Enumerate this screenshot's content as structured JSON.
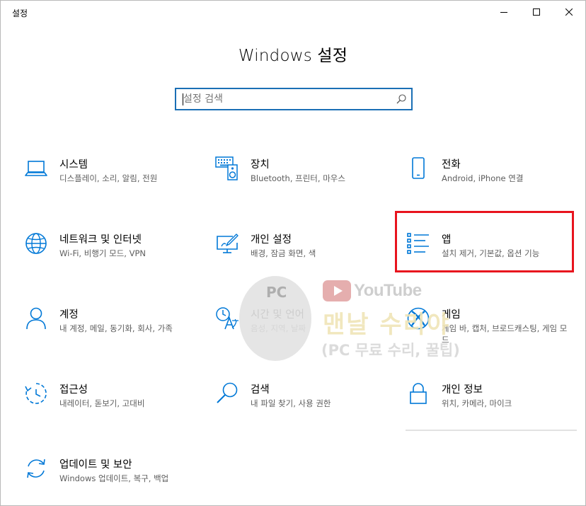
{
  "window": {
    "title": "설정",
    "buttons": {
      "minimize": "minimize",
      "maximize": "maximize",
      "close": "close"
    }
  },
  "main": {
    "title": "Windows 설정",
    "search": {
      "placeholder": "설정 검색",
      "value": ""
    }
  },
  "tiles": [
    {
      "title": "시스템",
      "desc": "디스플레이, 소리, 알림, 전원",
      "icon": "laptop-icon"
    },
    {
      "title": "장치",
      "desc": "Bluetooth, 프린터, 마우스",
      "icon": "keyboard-speaker-icon"
    },
    {
      "title": "전화",
      "desc": "Android, iPhone 연결",
      "icon": "phone-icon"
    },
    {
      "title": "네트워크 및 인터넷",
      "desc": "Wi-Fi, 비행기 모드, VPN",
      "icon": "globe-icon"
    },
    {
      "title": "개인 설정",
      "desc": "배경, 잠금 화면, 색",
      "icon": "monitor-pen-icon"
    },
    {
      "title": "앱",
      "desc": "설치 제거, 기본값, 옵션 기능",
      "icon": "app-list-icon"
    },
    {
      "title": "계정",
      "desc": "내 계정, 메일, 동기화, 회사, 가족",
      "icon": "person-icon"
    },
    {
      "title": "시간 및 언어",
      "desc": "음성, 지역, 날짜",
      "icon": "time-language-icon"
    },
    {
      "title": "게임",
      "desc": "게임 바, 캡처, 브로드캐스팅, 게임 모드",
      "icon": "xbox-icon"
    },
    {
      "title": "접근성",
      "desc": "내레이터, 돋보기, 고대비",
      "icon": "ease-of-access-icon"
    },
    {
      "title": "검색",
      "desc": "내 파일 찾기, 사용 권한",
      "icon": "magnifier-icon"
    },
    {
      "title": "개인 정보",
      "desc": "위치, 카메라, 마이크",
      "icon": "lock-icon"
    },
    {
      "title": "업데이트 및 보안",
      "desc": "Windows 업데이트, 복구, 백업",
      "icon": "sync-icon"
    }
  ],
  "watermark": {
    "badge": "PC",
    "youtube": "YouTube",
    "name": "맨날 수리야",
    "sub": "(PC 무료 수리, 꿀팁)"
  },
  "colors": {
    "accent": "#0078d7",
    "highlight": "#e8141e",
    "search_border": "#1a6fb5"
  }
}
